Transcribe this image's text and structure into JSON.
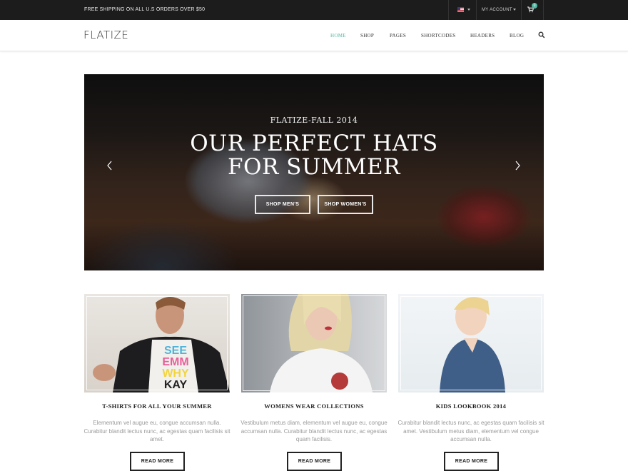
{
  "topbar": {
    "shipping": "FREE SHIPPING ON ALL U.S ORDERS OVER $50",
    "account": "MY ACCOUNT",
    "cart_count": "0"
  },
  "header": {
    "logo": "FLATIZE",
    "nav": [
      "HOME",
      "SHOP",
      "PAGES",
      "SHORTCODES",
      "HEADERS",
      "BLOG"
    ],
    "accent": "#4fb8a3"
  },
  "hero": {
    "subtitle": "FLATIZE-FALL 2014",
    "title_line1": "OUR PERFECT HATS",
    "title_line2": "FOR SUMMER",
    "btn_men": "SHOP MEN'S",
    "btn_women": "SHOP WOMEN'S"
  },
  "cards": [
    {
      "title": "T-SHIRTS FOR ALL YOUR SUMMER",
      "text": "Elementum vel augue eu, congue accumsan nulla. Curabitur blandit lectus nunc, ac egestas quam facilisis sit amet.",
      "button": "READ MORE",
      "shirt_text": [
        "SEE",
        "EMM",
        "WHY",
        "KAY"
      ]
    },
    {
      "title": "WOMENS WEAR COLLECTIONS",
      "text": "Vestibulum metus diam, elementum vel augue eu, congue accumsan nulla. Curabitur blandit lectus nunc, ac egestas quam facilisis.",
      "button": "READ MORE"
    },
    {
      "title": "KIDS LOOKBOOK 2014",
      "text": "Curabitur blandit lectus nunc, ac egestas quam facilisis sit amet. Vestibulum metus diam, elementum vel congue accumsan nulla.",
      "button": "READ MORE"
    }
  ]
}
